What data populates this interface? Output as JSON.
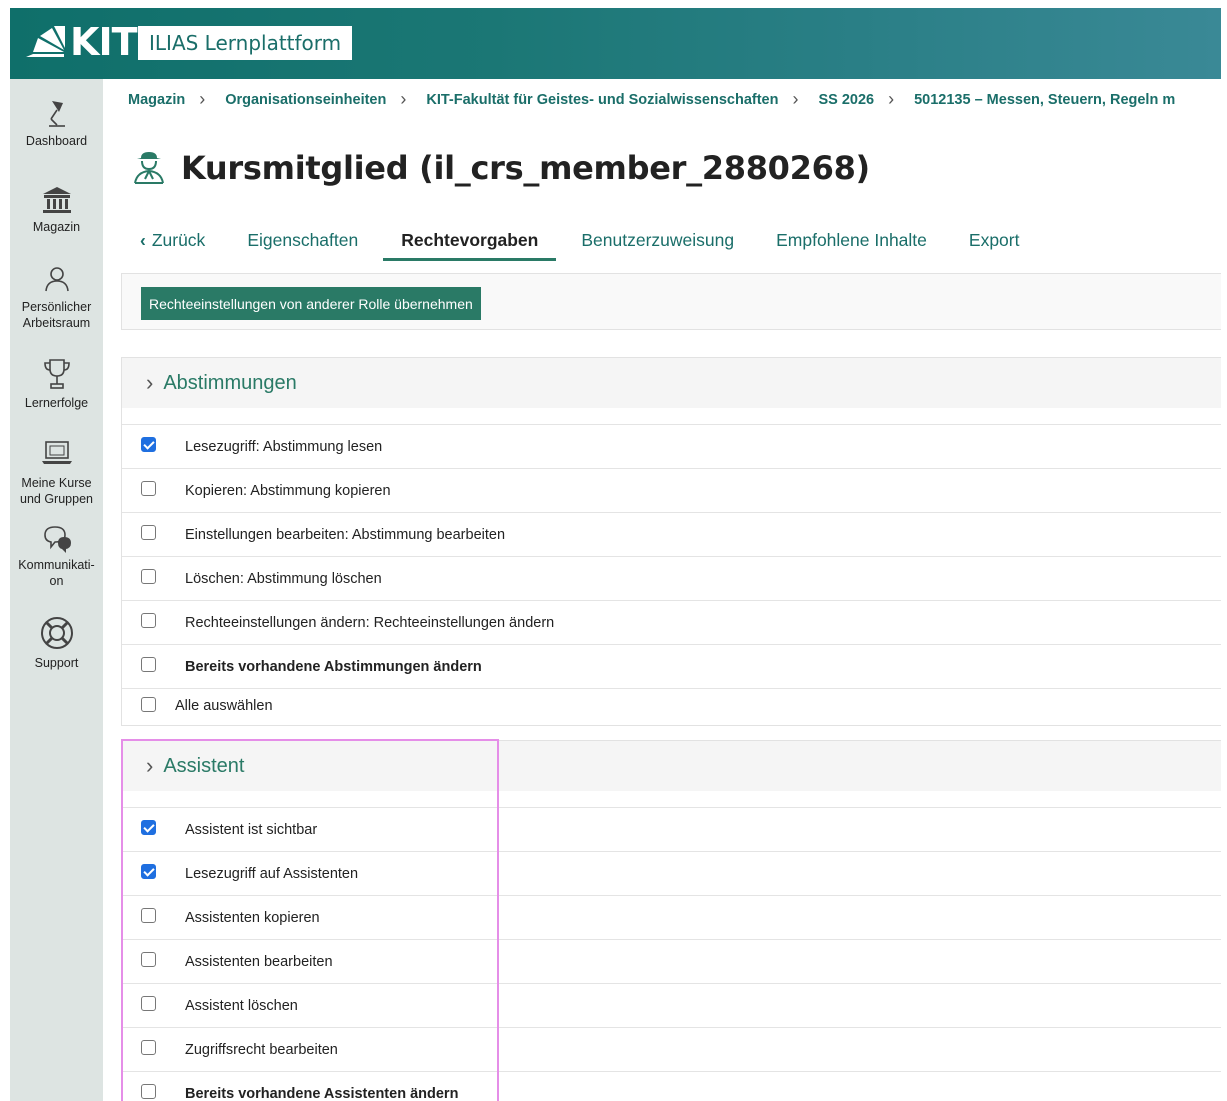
{
  "header": {
    "logo_text": "KIT",
    "app_title": "ILIAS Lernplattform"
  },
  "sidebar": {
    "items": [
      {
        "label": "Dashboard",
        "icon": "dashboard-icon"
      },
      {
        "label": "Magazin",
        "icon": "building-icon"
      },
      {
        "label_line1": "Persönlicher",
        "label_line2": "Arbeitsraum",
        "icon": "user-icon"
      },
      {
        "label": "Lernerfolge",
        "icon": "trophy-icon"
      },
      {
        "label_line1": "Meine Kurse",
        "label_line2": "und Gruppen",
        "icon": "laptop-icon"
      },
      {
        "label_line1": "Kommunikati-",
        "label_line2": "on",
        "icon": "chat-icon"
      },
      {
        "label": "Support",
        "icon": "lifebuoy-icon"
      }
    ]
  },
  "breadcrumb": [
    "Magazin",
    "Organisationseinheiten",
    "KIT-Fakultät für Geistes- und Sozialwissenschaften",
    "SS 2026",
    "5012135 – Messen, Steuern, Regeln m"
  ],
  "page": {
    "title": "Kursmitglied (il_crs_member_2880268)"
  },
  "tabs": {
    "back": "Zurück",
    "items": [
      "Eigenschaften",
      "Rechtevorgaben",
      "Benutzerzuweisung",
      "Empfohlene Inhalte",
      "Export"
    ],
    "active": "Rechtevorgaben"
  },
  "toolbar": {
    "copy_rights_label": "Rechteeinstellungen von anderer Rolle übernehmen"
  },
  "sections": [
    {
      "title": "Abstimmungen",
      "permissions": [
        {
          "label": "Lesezugriff: Abstimmung lesen",
          "checked": true
        },
        {
          "label": "Kopieren: Abstimmung kopieren",
          "checked": false
        },
        {
          "label": "Einstellungen bearbeiten: Abstimmung bearbeiten",
          "checked": false
        },
        {
          "label": "Löschen: Abstimmung löschen",
          "checked": false
        },
        {
          "label": "Rechteeinstellungen ändern: Rechteeinstellungen ändern",
          "checked": false
        },
        {
          "label": "Bereits vorhandene Abstimmungen ändern",
          "checked": false,
          "bold": true
        }
      ],
      "select_all": "Alle auswählen"
    },
    {
      "title": "Assistent",
      "permissions": [
        {
          "label": "Assistent ist sichtbar",
          "checked": true
        },
        {
          "label": "Lesezugriff auf Assistenten",
          "checked": true
        },
        {
          "label": "Assistenten kopieren",
          "checked": false
        },
        {
          "label": "Assistenten bearbeiten",
          "checked": false
        },
        {
          "label": "Assistent löschen",
          "checked": false
        },
        {
          "label": "Zugriffsrecht bearbeiten",
          "checked": false
        },
        {
          "label": "Bereits vorhandene Assistenten ändern",
          "checked": false,
          "bold": true
        }
      ]
    }
  ],
  "colors": {
    "brand_green": "#2a7a66",
    "link_teal": "#1a6e69",
    "checkbox_blue": "#1f6fe0",
    "highlight_pink": "#e58ee8"
  }
}
